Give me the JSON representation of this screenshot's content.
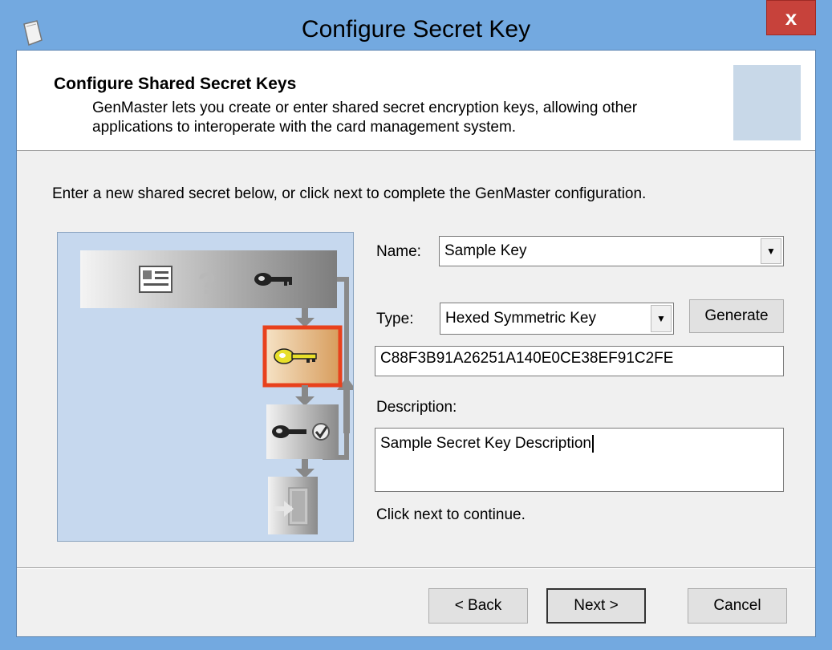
{
  "window": {
    "title": "Configure Secret Key",
    "close_label": "x"
  },
  "header": {
    "title": "Configure Shared Secret Keys",
    "description": "GenMaster lets you create or enter shared secret encryption keys, allowing other applications to interoperate with the card management system."
  },
  "intro": "Enter a new shared secret below, or click next to complete the GenMaster configuration.",
  "form": {
    "name_label": "Name:",
    "name_value": "Sample Key",
    "type_label": "Type:",
    "type_value": "Hexed Symmetric Key",
    "generate_label": "Generate",
    "key_value": "C88F3B91A26251A140E0CE38EF91C2FE",
    "description_label": "Description:",
    "description_value": "Sample Secret Key Description",
    "hint": "Click next to continue."
  },
  "illustration": {
    "question_mark": "?"
  },
  "buttons": {
    "back": "< Back",
    "next": "Next >",
    "cancel": "Cancel"
  },
  "colors": {
    "titlebar": "#73a9e0",
    "close_button": "#c7423b",
    "highlight_border": "#e8411c",
    "illustration_bg": "#c6d8ee",
    "key_yellow": "#e8df2a"
  }
}
